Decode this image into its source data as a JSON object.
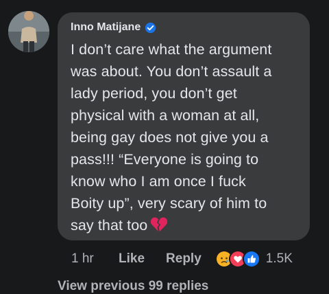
{
  "comment": {
    "author": "Inno Matijane",
    "verified_icon": "verified-badge-icon",
    "text": "I don’t care what the argument\nwas about. You don’t assault a\nlady period, you don’t get\nphysical with a woman at all,\nbeing gay does not give you a\npass!!! “Everyone is going to\nknow who I am once I fuck\nBoity up”, very scary of him to\nsay that too",
    "emoji": "broken-heart-icon"
  },
  "actions": {
    "timestamp": "1 hr",
    "like": "Like",
    "reply": "Reply",
    "reactions": [
      "sad-face-icon",
      "love-heart-icon",
      "thumbs-up-icon"
    ],
    "reaction_count": "1.5K"
  },
  "view_more": "View previous 99 replies",
  "colors": {
    "background": "#18191a",
    "bubble": "#3a3b3c",
    "text": "#e4e6eb",
    "muted": "#b0b3b8",
    "verified": "#1b74e4"
  }
}
